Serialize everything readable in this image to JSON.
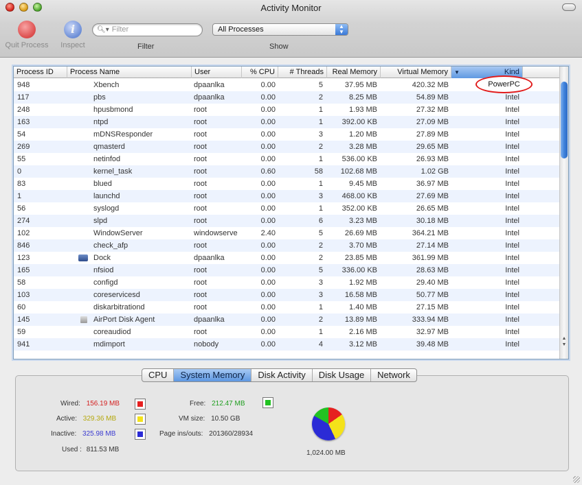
{
  "window": {
    "title": "Activity Monitor"
  },
  "toolbar": {
    "quit_label": "Quit Process",
    "inspect_label": "Inspect",
    "filter_placeholder": "Filter",
    "filter_label": "Filter",
    "show_value": "All Processes",
    "show_label": "Show"
  },
  "columns": [
    "Process ID",
    "Process Name",
    "User",
    "% CPU",
    "# Threads",
    "Real Memory",
    "Virtual Memory",
    "Kind"
  ],
  "processes": [
    {
      "pid": "948",
      "name": "Xbench",
      "user": "dpaanlka",
      "cpu": "0.00",
      "threads": "5",
      "real": "37.95 MB",
      "virtual": "420.32 MB",
      "kind": "PowerPC"
    },
    {
      "pid": "117",
      "name": "pbs",
      "user": "dpaanlka",
      "cpu": "0.00",
      "threads": "2",
      "real": "8.25 MB",
      "virtual": "54.89 MB",
      "kind": "Intel"
    },
    {
      "pid": "248",
      "name": "hpusbmond",
      "user": "root",
      "cpu": "0.00",
      "threads": "1",
      "real": "1.93 MB",
      "virtual": "27.32 MB",
      "kind": "Intel"
    },
    {
      "pid": "163",
      "name": "ntpd",
      "user": "root",
      "cpu": "0.00",
      "threads": "1",
      "real": "392.00 KB",
      "virtual": "27.09 MB",
      "kind": "Intel"
    },
    {
      "pid": "54",
      "name": "mDNSResponder",
      "user": "root",
      "cpu": "0.00",
      "threads": "3",
      "real": "1.20 MB",
      "virtual": "27.89 MB",
      "kind": "Intel"
    },
    {
      "pid": "269",
      "name": "qmasterd",
      "user": "root",
      "cpu": "0.00",
      "threads": "2",
      "real": "3.28 MB",
      "virtual": "29.65 MB",
      "kind": "Intel"
    },
    {
      "pid": "55",
      "name": "netinfod",
      "user": "root",
      "cpu": "0.00",
      "threads": "1",
      "real": "536.00 KB",
      "virtual": "26.93 MB",
      "kind": "Intel"
    },
    {
      "pid": "0",
      "name": "kernel_task",
      "user": "root",
      "cpu": "0.60",
      "threads": "58",
      "real": "102.68 MB",
      "virtual": "1.02 GB",
      "kind": "Intel"
    },
    {
      "pid": "83",
      "name": "blued",
      "user": "root",
      "cpu": "0.00",
      "threads": "1",
      "real": "9.45 MB",
      "virtual": "36.97 MB",
      "kind": "Intel"
    },
    {
      "pid": "1",
      "name": "launchd",
      "user": "root",
      "cpu": "0.00",
      "threads": "3",
      "real": "468.00 KB",
      "virtual": "27.69 MB",
      "kind": "Intel"
    },
    {
      "pid": "56",
      "name": "syslogd",
      "user": "root",
      "cpu": "0.00",
      "threads": "1",
      "real": "352.00 KB",
      "virtual": "26.65 MB",
      "kind": "Intel"
    },
    {
      "pid": "274",
      "name": "slpd",
      "user": "root",
      "cpu": "0.00",
      "threads": "6",
      "real": "3.23 MB",
      "virtual": "30.18 MB",
      "kind": "Intel"
    },
    {
      "pid": "102",
      "name": "WindowServer",
      "user": "windowserve",
      "cpu": "2.40",
      "threads": "5",
      "real": "26.69 MB",
      "virtual": "364.21 MB",
      "kind": "Intel"
    },
    {
      "pid": "846",
      "name": "check_afp",
      "user": "root",
      "cpu": "0.00",
      "threads": "2",
      "real": "3.70 MB",
      "virtual": "27.14 MB",
      "kind": "Intel"
    },
    {
      "pid": "123",
      "name": "Dock",
      "user": "dpaanlka",
      "cpu": "0.00",
      "threads": "2",
      "real": "23.85 MB",
      "virtual": "361.99 MB",
      "kind": "Intel",
      "icon": "dock-icon"
    },
    {
      "pid": "165",
      "name": "nfsiod",
      "user": "root",
      "cpu": "0.00",
      "threads": "5",
      "real": "336.00 KB",
      "virtual": "28.63 MB",
      "kind": "Intel"
    },
    {
      "pid": "58",
      "name": "configd",
      "user": "root",
      "cpu": "0.00",
      "threads": "3",
      "real": "1.92 MB",
      "virtual": "29.40 MB",
      "kind": "Intel"
    },
    {
      "pid": "103",
      "name": "coreservicesd",
      "user": "root",
      "cpu": "0.00",
      "threads": "3",
      "real": "16.58 MB",
      "virtual": "50.77 MB",
      "kind": "Intel"
    },
    {
      "pid": "60",
      "name": "diskarbitrationd",
      "user": "root",
      "cpu": "0.00",
      "threads": "1",
      "real": "1.40 MB",
      "virtual": "27.15 MB",
      "kind": "Intel"
    },
    {
      "pid": "145",
      "name": "AirPort Disk Agent",
      "user": "dpaanlka",
      "cpu": "0.00",
      "threads": "2",
      "real": "13.89 MB",
      "virtual": "333.94 MB",
      "kind": "Intel",
      "icon": "airport-disk-icon"
    },
    {
      "pid": "59",
      "name": "coreaudiod",
      "user": "root",
      "cpu": "0.00",
      "threads": "1",
      "real": "2.16 MB",
      "virtual": "32.97 MB",
      "kind": "Intel"
    },
    {
      "pid": "941",
      "name": "mdimport",
      "user": "nobody",
      "cpu": "0.00",
      "threads": "4",
      "real": "3.12 MB",
      "virtual": "39.48 MB",
      "kind": "Intel"
    }
  ],
  "tabs": [
    "CPU",
    "System Memory",
    "Disk Activity",
    "Disk Usage",
    "Network"
  ],
  "active_tab": "System Memory",
  "memory": {
    "wired_label": "Wired:",
    "wired": "156.19 MB",
    "active_label": "Active:",
    "active": "329.36 MB",
    "inactive_label": "Inactive:",
    "inactive": "325.98 MB",
    "used_label": "Used :",
    "used": "811.53 MB",
    "free_label": "Free:",
    "free": "212.47 MB",
    "vm_label": "VM size:",
    "vm": "10.50 GB",
    "pageins_label": "Page ins/outs:",
    "pageins": "201360/28934",
    "total": "1,024.00 MB"
  },
  "colors": {
    "wired": "#e62020",
    "active": "#f4e21a",
    "inactive": "#2b2bd6",
    "free": "#22c222",
    "accent": "#5d97e2"
  }
}
